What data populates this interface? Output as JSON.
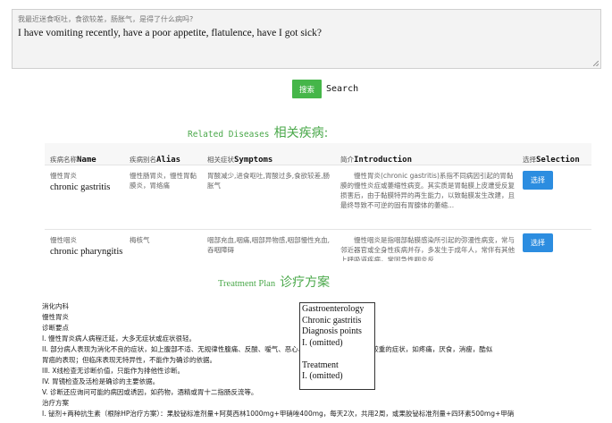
{
  "query": {
    "zh": "我最近迷食呕吐，食欲较差，肠胀气，是得了什么病吗?",
    "en": "I have vomiting recently, have a poor appetite, flatulence, have I got sick?"
  },
  "search": {
    "button_label": "搜索",
    "label": "Search"
  },
  "related": {
    "title_en": "Related Diseases",
    "title_zh": "相关疾病:",
    "headers": {
      "name": {
        "zh": "疾病名称",
        "en": "Name"
      },
      "alias": {
        "zh": "疾病别名",
        "en": "Alias"
      },
      "symptoms": {
        "zh": "相关症状",
        "en": "Symptoms"
      },
      "intro": {
        "zh": "简介",
        "en": "Introduction"
      },
      "selection": {
        "zh": "选择",
        "en": "Selection"
      }
    },
    "rows": [
      {
        "name_zh": "慢性胃炎",
        "name_en": "chronic gastritis",
        "alias": "慢性肠胃炎，慢性胃黏膜炎，胃络痛",
        "symptoms": "胃酸减少,进食呕吐,胃酸过多,食欲较差,肠胀气",
        "intro": "慢性胃炎(chronic gastritis)系指不同病因引起的胃黏膜的慢性炎症或萎缩性病变。其实质是胃黏膜上皮遭受反复损害后，由于黏膜特异的再生能力，以致黏膜发生改建，且最终导致不可逆的固有胃腺体的萎缩...",
        "select_label": "选择"
      },
      {
        "name_zh": "慢性咽炎",
        "name_en": "chronic pharyngitis",
        "alias": "梅核气",
        "symptoms": "咽部充血,咽痛,咽部异物感,咽部慢性充血,吞咽障碍",
        "intro": "慢性咽炎是指咽部黏膜感染所引起的弥漫性病变，常与邻近器官或全身性疾病并存，多发生于成年人，常伴有其他上呼吸道疾病，常因急性咽炎反...",
        "select_label": "选择"
      }
    ]
  },
  "treatment": {
    "title_en": "Treatment Plan",
    "title_zh": "诊疗方案",
    "lines": [
      "消化内科",
      "慢性胃炎",
      "诊断要点",
      "I. 慢性胃炎病人病程迁延，大多无症状或症状很轻。",
      "II. 部分病人表现为消化不良的症状，如上腹部不适、无规律性腹痛、反酸、嗳气、恶心、呕吐等，少数病例出现较重的症状，如疼痛，厌食，消瘦，酷似",
      "胃癌的表现；但临床表现无特异性，不能作为确诊的依据。",
      "III. X线检查无诊断价值，只能作为排他性诊断。",
      "IV. 胃镜检查及活检是确诊的主要依据。",
      "V. 诊断还应询问可能的病因或诱因，如药物，酒精或胃十二指肠反流等。",
      "治疗方案",
      "I. 铋剂+两种抗生素（根除HP治疗方案）：果胶铋标准剂量+阿莫西林1000mg+甲硝唑400mg，每天2次，共用2周，或果胶铋标准剂量+四环素500mg+甲硝"
    ],
    "translation": [
      "Gastroenterology",
      "Chronic gastritis",
      "Diagnosis points",
      "I. (omitted)",
      "",
      "Treatment",
      "I. (omitted)"
    ]
  },
  "colors": {
    "accent_green": "#45b649",
    "title_green": "#4aa84a",
    "select_blue": "#2c8de0"
  }
}
